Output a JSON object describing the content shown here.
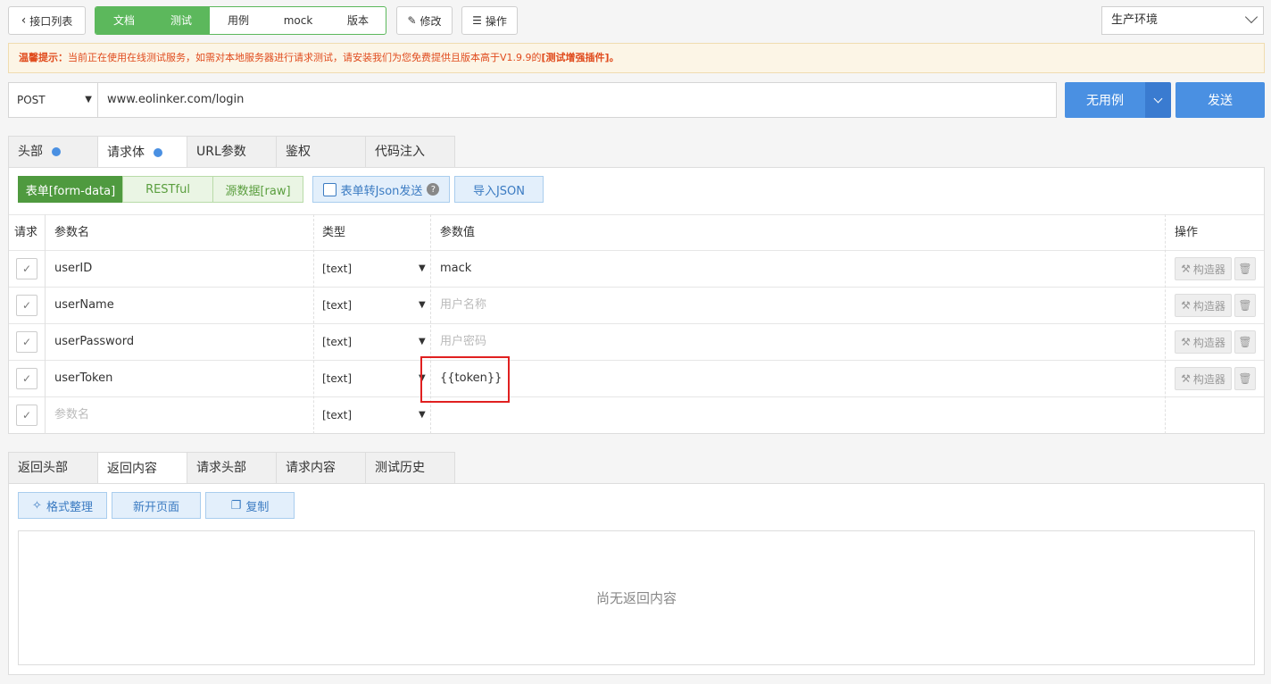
{
  "toolbar": {
    "back_label": "接口列表",
    "seg_tabs": [
      "文档",
      "测试",
      "用例",
      "mock",
      "版本"
    ],
    "edit_label": "修改",
    "ops_label": "操作",
    "env_selected": "生产环境"
  },
  "notice": {
    "prefix": "温馨提示：",
    "text": "当前正在使用在线测试服务，如需对本地服务器进行请求测试，请安装我们为您免费提供且版本高于V1.9.9的",
    "link": "[测试增强插件]。"
  },
  "request": {
    "method": "POST",
    "url": "www.eolinker.com/login",
    "case_label": "无用例",
    "send_label": "发送"
  },
  "req_tabs": [
    "头部",
    "请求体",
    "URL参数",
    "鉴权",
    "代码注入"
  ],
  "body_modes": [
    "表单[form-data]",
    "RESTful",
    "源数据[raw]"
  ],
  "json_toggle_label": "表单转Json发送",
  "import_json_label": "导入JSON",
  "table": {
    "headers": [
      "请求",
      "参数名",
      "类型",
      "参数值",
      "操作"
    ],
    "rows": [
      {
        "name": "userID",
        "type": "[text]",
        "value": "mack",
        "placeholder": ""
      },
      {
        "name": "userName",
        "type": "[text]",
        "value": "",
        "placeholder": "用户名称"
      },
      {
        "name": "userPassword",
        "type": "[text]",
        "value": "",
        "placeholder": "用户密码"
      },
      {
        "name": "userToken",
        "type": "[text]",
        "value": "{{token}}",
        "placeholder": ""
      }
    ],
    "new_row": {
      "name_placeholder": "参数名",
      "type": "[text]"
    },
    "builder_label": "构造器"
  },
  "resp_tabs": [
    "返回头部",
    "返回内容",
    "请求头部",
    "请求内容",
    "测试历史"
  ],
  "resp_actions": {
    "format": "格式整理",
    "new_page": "新开页面",
    "copy": "复制"
  },
  "resp_empty": "尚无返回内容",
  "colors": {
    "green": "#4f9a3f",
    "blue": "#4a90e2",
    "highlight": "#e02020"
  }
}
